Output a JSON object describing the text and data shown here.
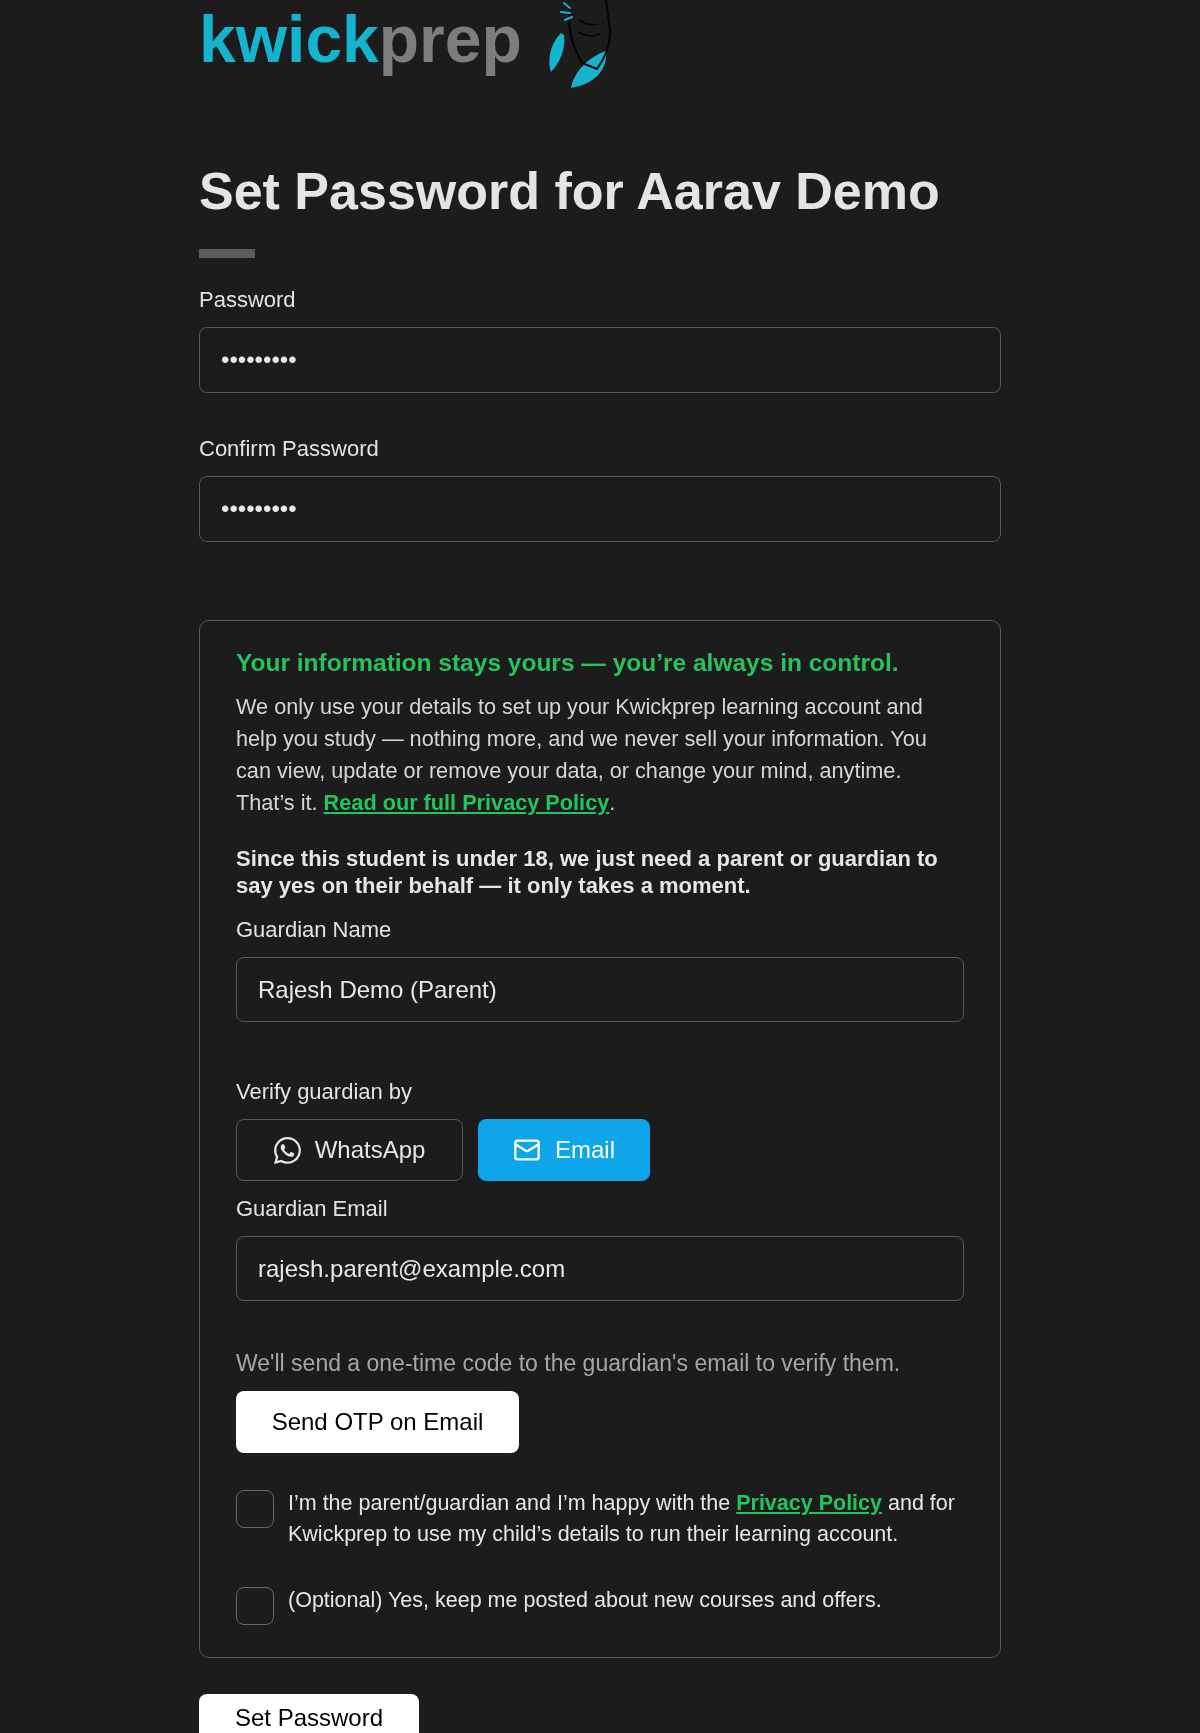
{
  "logo": {
    "parts": [
      {
        "text": "kwick",
        "color": "#14b4cf"
      },
      {
        "text": "prep",
        "color": "#7d7d7e"
      }
    ]
  },
  "title": "Set Password for Aarav Demo",
  "password_fields": [
    {
      "label": "Password",
      "value": "•••••••••"
    },
    {
      "label": "Confirm Password",
      "value": "•••••••••"
    }
  ],
  "consent": {
    "heading": "Your information stays yours — you’re always in control.",
    "body": [
      {
        "kind": "text",
        "text": "We only use your details to set up your Kwickprep learning account and help you study — nothing more, and we never sell your information. You can view, update or remove your data, or change your mind, anytime. That’s it. "
      },
      {
        "kind": "link",
        "text": "Read our full Privacy Policy"
      },
      {
        "kind": "text",
        "text": "."
      }
    ],
    "notice": "Since this student is under 18, we just need a parent or guardian to say yes on their behalf — it only takes a moment.",
    "guardian_name": {
      "label": "Guardian Name",
      "value": "Rajesh Demo (Parent)"
    },
    "verify": {
      "label": "Verify guardian by",
      "options": [
        {
          "kind": "whatsapp",
          "label": "WhatsApp",
          "selected": false
        },
        {
          "kind": "email",
          "label": "Email",
          "selected": true
        }
      ]
    },
    "guardian_email": {
      "label": "Guardian Email",
      "value": "rajesh.parent@example.com"
    },
    "hint": "We'll send a one-time code to the guardian's email to verify them.",
    "send_button": "Send OTP on Email",
    "checkboxes": [
      {
        "checked": false,
        "parts": [
          {
            "kind": "text",
            "text": "I’m the parent/guardian and I’m happy with the "
          },
          {
            "kind": "link",
            "text": "Privacy Policy"
          },
          {
            "kind": "text",
            "text": " and for Kwickprep to use my child’s details to run their learning account."
          }
        ]
      },
      {
        "checked": false,
        "parts": [
          {
            "kind": "text",
            "text": "(Optional) Yes, keep me posted about new courses and offers."
          }
        ]
      }
    ]
  },
  "submit_button": "Set Password"
}
